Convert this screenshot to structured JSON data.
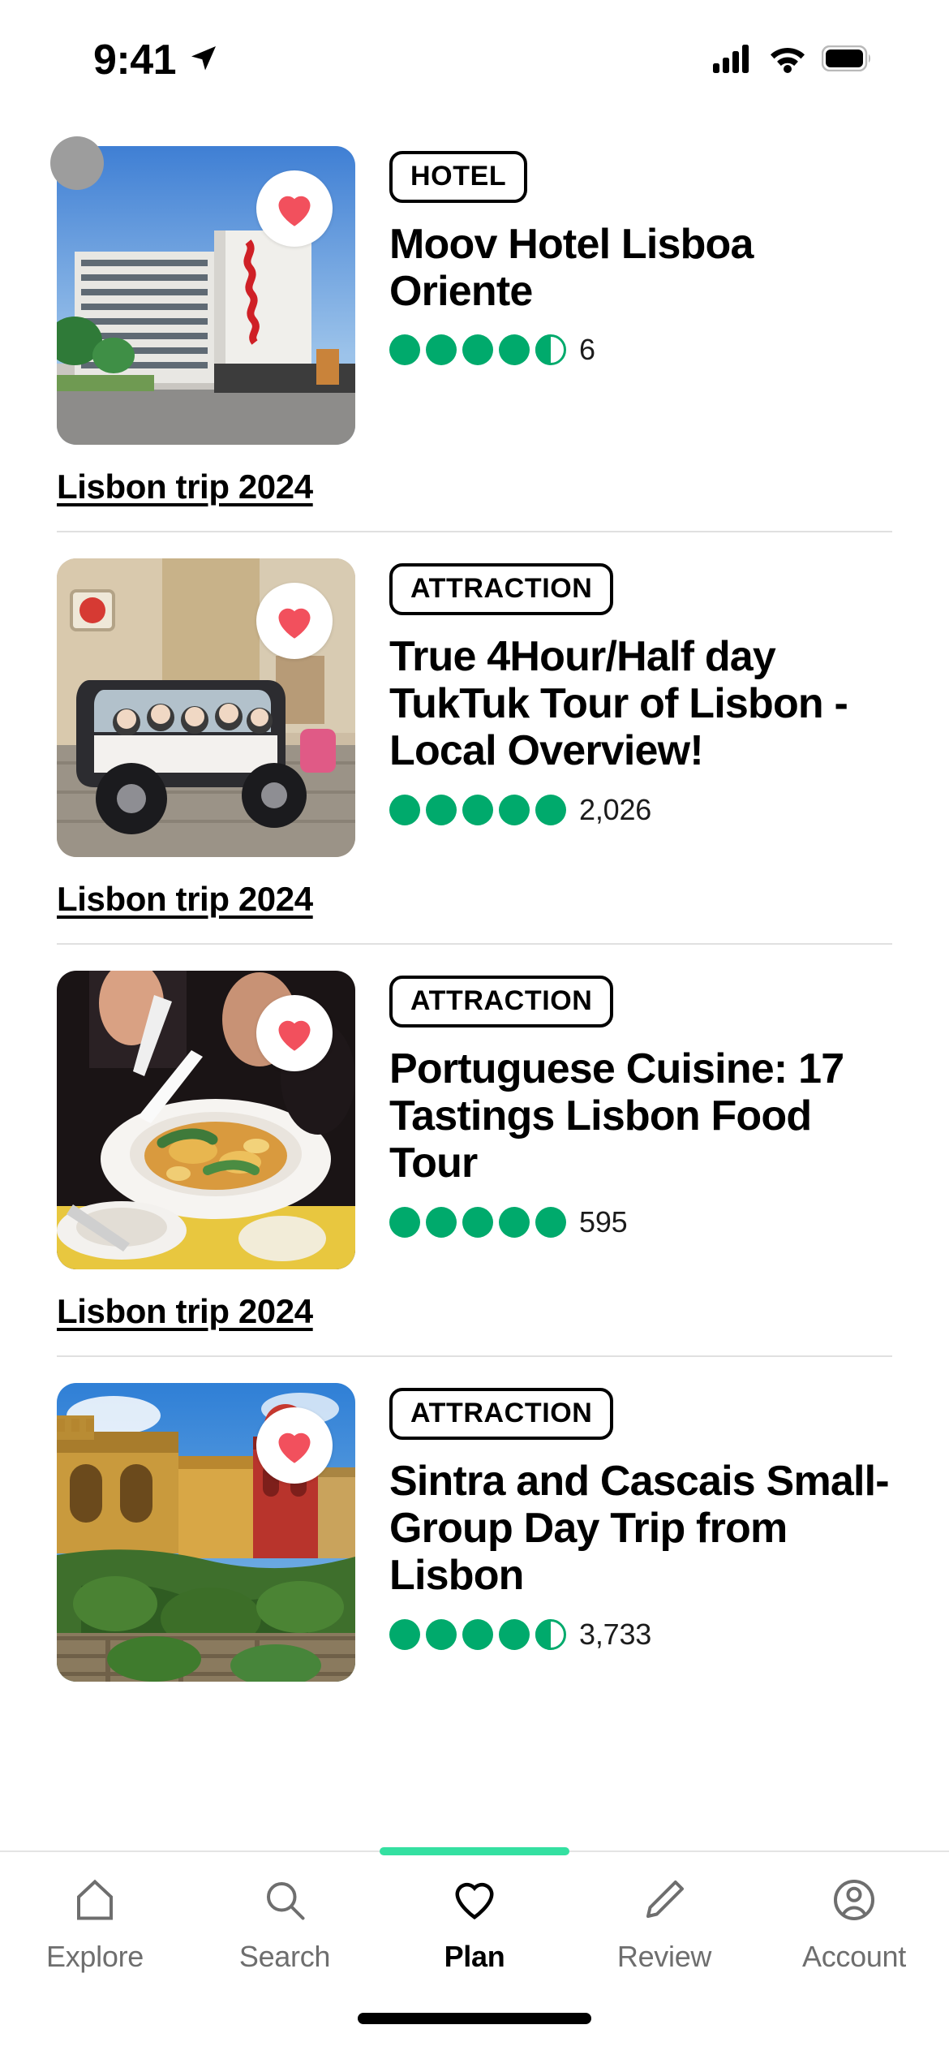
{
  "status_bar": {
    "time": "9:41",
    "location_icon": "location-arrow-icon",
    "signal_icon": "cellular-signal-icon",
    "wifi_icon": "wifi-icon",
    "battery_icon": "battery-full-icon"
  },
  "cards": [
    {
      "badge": "HOTEL",
      "title": "Moov Hotel Lisboa Oriente",
      "rating": 4.5,
      "full_bubbles": 4,
      "has_half": true,
      "review_count": "6",
      "trip_link": "Lisbon trip 2024",
      "heart_icon": "heart-filled-icon",
      "heart_color": "#f2505d",
      "image_alt": "hotel-building-exterior"
    },
    {
      "badge": "ATTRACTION",
      "title": "True 4Hour/Half day TukTuk Tour of Lisbon - Local Overview!",
      "rating": 5.0,
      "full_bubbles": 5,
      "has_half": false,
      "review_count": "2,026",
      "trip_link": "Lisbon trip 2024",
      "heart_icon": "heart-filled-icon",
      "heart_color": "#f2505d",
      "image_alt": "tuktuk-tour-vehicle-with-people"
    },
    {
      "badge": "ATTRACTION",
      "title": "Portuguese Cuisine: 17 Tastings Lisbon Food Tour",
      "rating": 5.0,
      "full_bubbles": 5,
      "has_half": false,
      "review_count": "595",
      "trip_link": "Lisbon trip 2024",
      "heart_icon": "heart-filled-icon",
      "heart_color": "#f2505d",
      "image_alt": "plate-of-portuguese-food"
    },
    {
      "badge": "ATTRACTION",
      "title": "Sintra and Cascais Small-Group Day Trip from Lisbon",
      "rating": 4.5,
      "full_bubbles": 4,
      "has_half": true,
      "review_count": "3,733",
      "trip_link": "",
      "heart_icon": "heart-filled-icon",
      "heart_color": "#f2505d",
      "image_alt": "pena-palace-sintra"
    }
  ],
  "bottom_nav": {
    "active_indicator_color": "#34e0a1",
    "items": [
      {
        "label": "Explore",
        "icon": "home-icon",
        "active": false
      },
      {
        "label": "Search",
        "icon": "search-icon",
        "active": false
      },
      {
        "label": "Plan",
        "icon": "heart-outline-icon",
        "active": true
      },
      {
        "label": "Review",
        "icon": "pencil-icon",
        "active": false
      },
      {
        "label": "Account",
        "icon": "account-circle-icon",
        "active": false
      }
    ]
  },
  "colors": {
    "rating_green": "#00aa6c",
    "accent_green": "#34e0a1",
    "heart_red": "#f2505d"
  }
}
